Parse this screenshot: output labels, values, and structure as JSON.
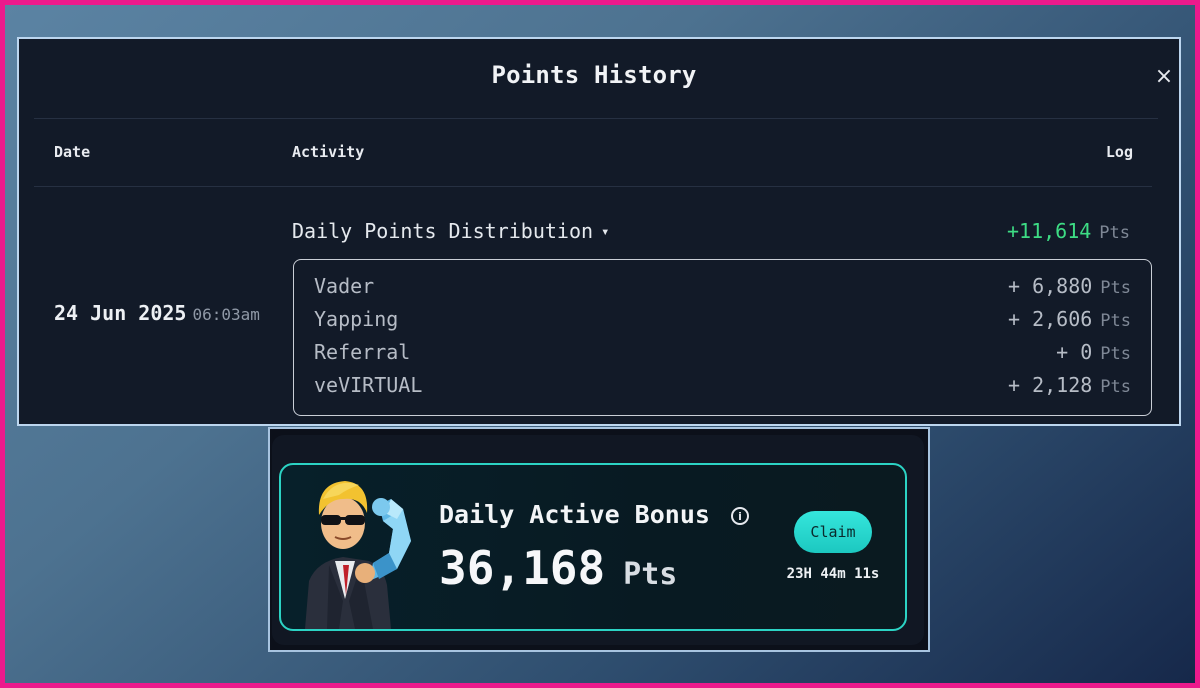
{
  "points_history": {
    "title": "Points History",
    "close_icon": "×",
    "columns": {
      "date": "Date",
      "activity": "Activity",
      "log": "Log"
    },
    "entry": {
      "date": "24 Jun 2025",
      "time": "06:03am",
      "activity": "Daily Points Distribution",
      "caret": "▾",
      "total": "+11,614",
      "unit": "Pts",
      "breakdown": [
        {
          "label": "Vader",
          "value": "+ 6,880",
          "unit": "Pts"
        },
        {
          "label": "Yapping",
          "value": "+ 2,606",
          "unit": "Pts"
        },
        {
          "label": "Referral",
          "value": "+ 0",
          "unit": "Pts"
        },
        {
          "label": "veVIRTUAL",
          "value": "+ 2,128",
          "unit": "Pts"
        }
      ]
    }
  },
  "daily_bonus": {
    "title": "Daily Active Bonus",
    "info_icon": "i",
    "value": "36,168",
    "unit": "Pts",
    "claim_label": "Claim",
    "countdown": "23H 44m 11s"
  },
  "colors": {
    "positive": "#3ddc84",
    "accent": "#2cd3c4",
    "frame": "#ec1a8c"
  },
  "icons": [
    "close-icon",
    "caret-down-icon",
    "info-icon",
    "mascot-avatar"
  ]
}
